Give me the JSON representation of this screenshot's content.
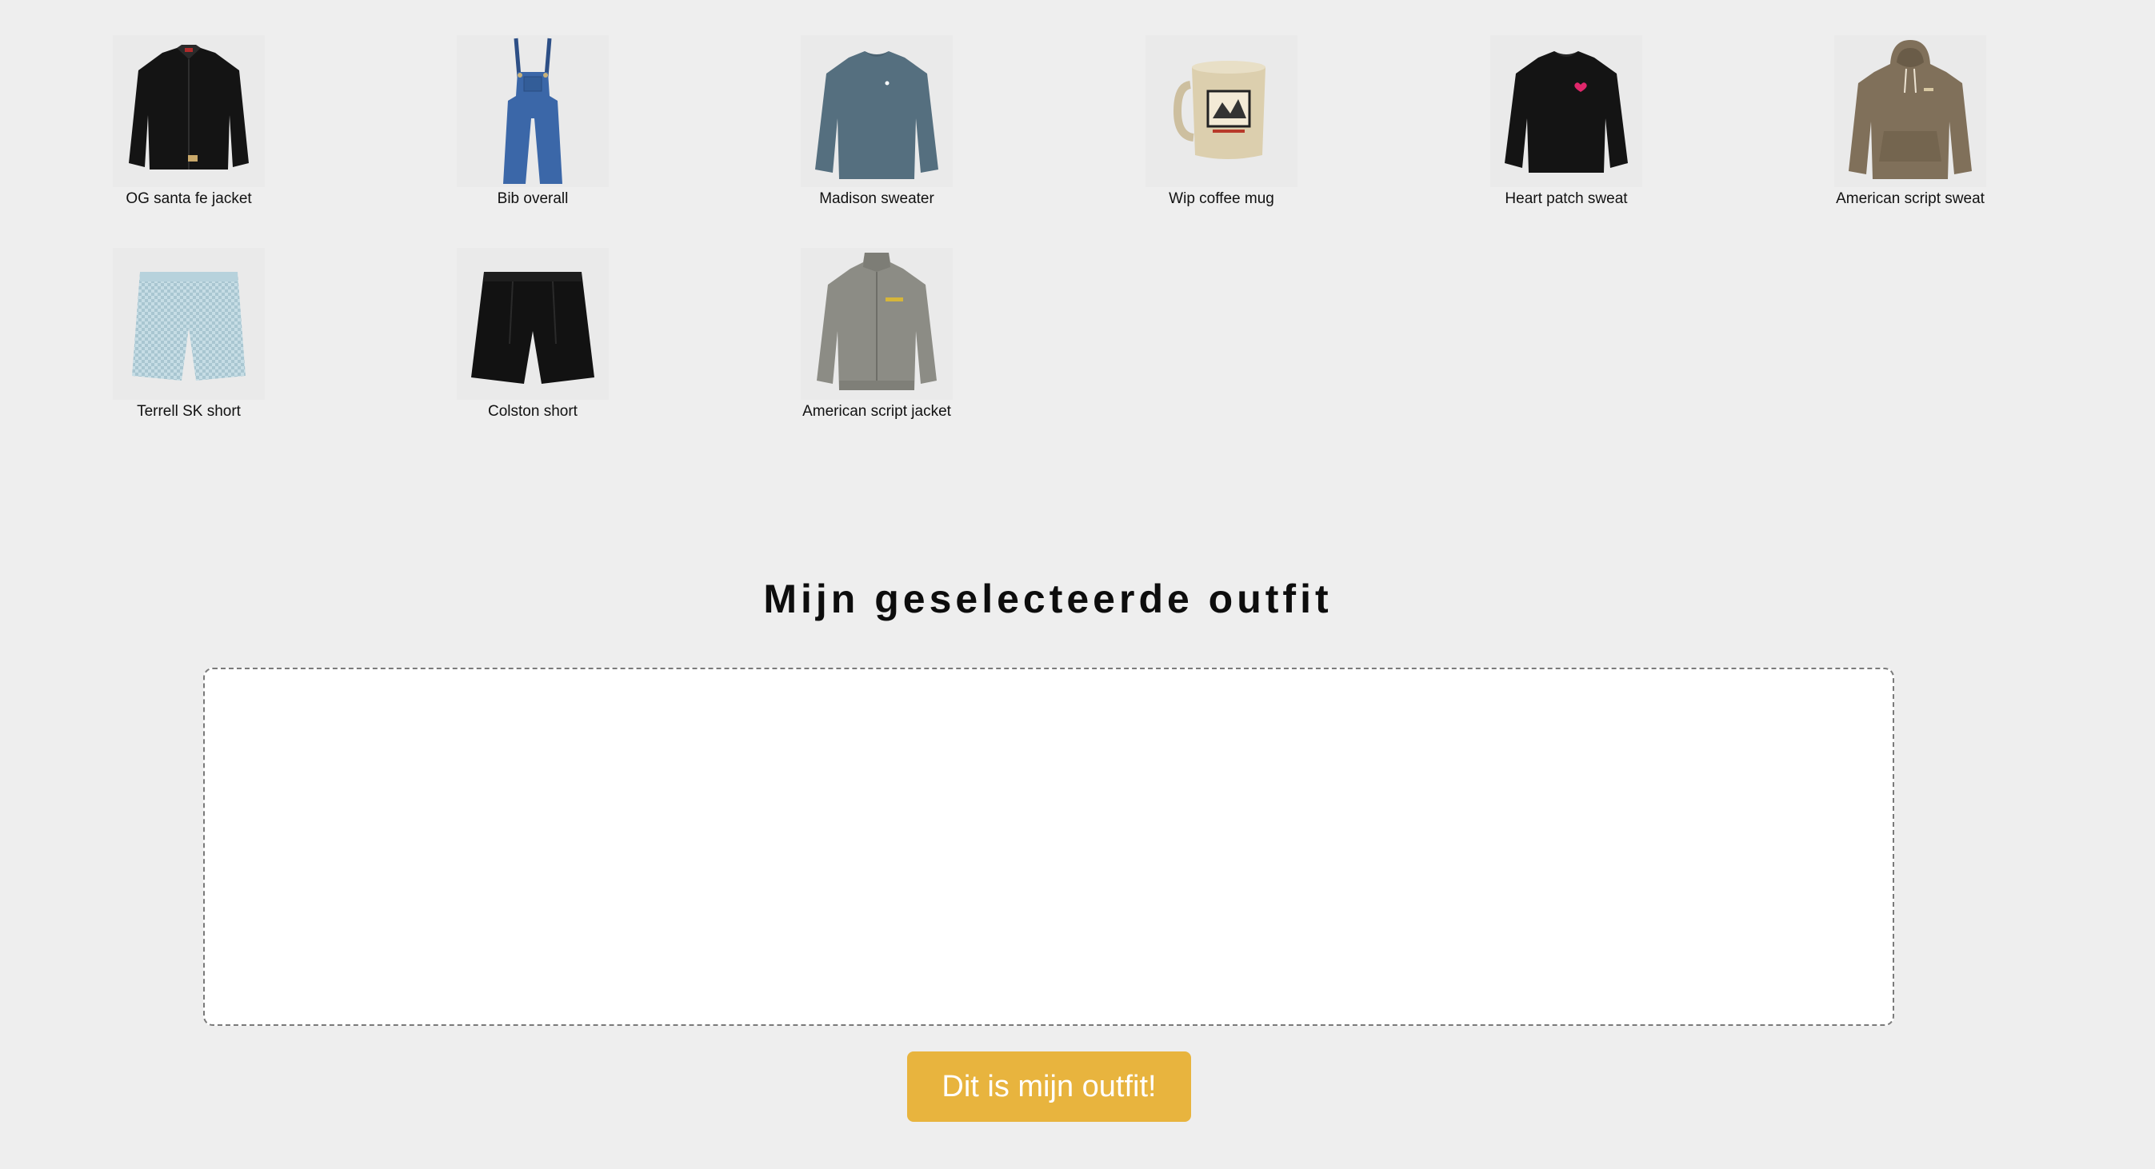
{
  "products": [
    {
      "name": "OG santa fe jacket",
      "icon": "black-jacket-image"
    },
    {
      "name": "Bib overall",
      "icon": "denim-overall-image"
    },
    {
      "name": "Madison sweater",
      "icon": "blue-sweater-image"
    },
    {
      "name": "Wip coffee mug",
      "icon": "coffee-mug-image"
    },
    {
      "name": "Heart patch sweat",
      "icon": "black-sweatshirt-image"
    },
    {
      "name": "American script sweat",
      "icon": "brown-hoodie-image"
    },
    {
      "name": "Terrell SK short",
      "icon": "light-blue-shorts-image"
    },
    {
      "name": "Colston short",
      "icon": "black-shorts-image"
    },
    {
      "name": "American script jacket",
      "icon": "grey-track-jacket-image"
    }
  ],
  "outfit": {
    "title": "Mijn geselecteerde outfit",
    "submit_label": "Dit is mijn outfit!"
  },
  "colors": {
    "background": "#eeeeee",
    "dropzone": "#ffffff",
    "button": "#e8b43e",
    "button_text": "#ffffff"
  }
}
